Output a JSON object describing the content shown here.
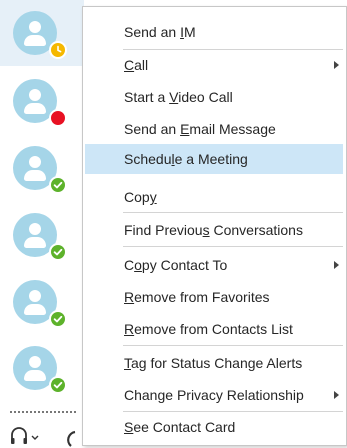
{
  "contact_list": {
    "contacts": [
      {
        "status": "away",
        "status_color": "#f5b800"
      },
      {
        "status": "busy",
        "status_color": "#e81123"
      },
      {
        "status": "available",
        "status_color": "#5db22b"
      },
      {
        "status": "available",
        "status_color": "#5db22b"
      },
      {
        "status": "available",
        "status_color": "#5db22b"
      },
      {
        "status": "available",
        "status_color": "#5db22b"
      }
    ],
    "avatar_color": "#a5d5e8",
    "selected_row_color": "#e6f0f8"
  },
  "toolbar": {
    "icons": [
      "headset-icon",
      "dropdown-arrow-icon",
      "phone-icon"
    ]
  },
  "context_menu": {
    "highlight_color": "#cde6f7",
    "items": [
      {
        "pre": "Send an ",
        "key": "I",
        "post": "M",
        "submenu": false
      },
      {
        "pre": "",
        "key": "C",
        "post": "all",
        "submenu": true
      },
      {
        "pre": "Start a ",
        "key": "V",
        "post": "ideo Call",
        "submenu": false
      },
      {
        "pre": "Send an ",
        "key": "E",
        "post": "mail Message",
        "submenu": false
      },
      {
        "pre": "Schedu",
        "key": "l",
        "post": "e a Meeting",
        "submenu": false,
        "highlighted": true
      },
      {
        "pre": "Cop",
        "key": "y",
        "post": "",
        "submenu": false
      },
      {
        "pre": "Find Previou",
        "key": "s",
        "post": " Conversations",
        "submenu": false
      },
      {
        "pre": "C",
        "key": "o",
        "post": "py Contact To",
        "submenu": true
      },
      {
        "pre": "",
        "key": "R",
        "post": "emove from Favorites",
        "submenu": false
      },
      {
        "pre": "",
        "key": "R",
        "post": "emove from Contacts List",
        "submenu": false
      },
      {
        "pre": "",
        "key": "T",
        "post": "ag for Status Change Alerts",
        "submenu": false
      },
      {
        "pre": "Chan",
        "key": "g",
        "post": "e Privacy Relationship",
        "submenu": true
      },
      {
        "pre": "",
        "key": "S",
        "post": "ee Contact Card",
        "submenu": false
      }
    ]
  }
}
